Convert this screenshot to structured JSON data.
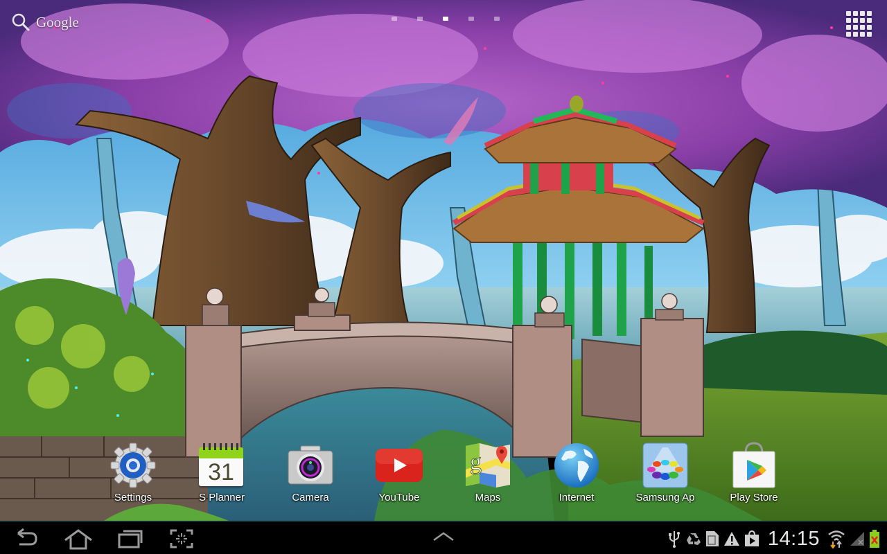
{
  "home_screen": {
    "search_widget": {
      "label": "Google",
      "icon": "search-icon"
    },
    "page_indicator": {
      "page_count": 5,
      "current_page": 3
    },
    "apps_button": {
      "icon": "apps-grid-icon"
    },
    "wallpaper": {
      "description": "Magic garden live wallpaper: purple blossom trees, Chinese pagoda, stone bridge, sea and clouds",
      "colors": {
        "sky": "#5fb8e6",
        "blossom": "#9a4fb5",
        "sea": "#7fb6c6",
        "grass": "#6c9a2a",
        "bark": "#6b4a2c",
        "pagoda_green": "#1fa34a",
        "pagoda_red": "#d8404c"
      }
    },
    "dock": [
      {
        "label": "Settings",
        "icon": "settings-gear-icon"
      },
      {
        "label": "S Planner",
        "icon": "calendar-icon",
        "calendar_day": "31"
      },
      {
        "label": "Camera",
        "icon": "camera-icon"
      },
      {
        "label": "YouTube",
        "icon": "youtube-play-icon"
      },
      {
        "label": "Maps",
        "icon": "maps-icon"
      },
      {
        "label": "Internet",
        "icon": "globe-icon"
      },
      {
        "label": "Samsung Ap",
        "icon": "samsung-apps-icon"
      },
      {
        "label": "Play Store",
        "icon": "play-store-bag-icon"
      }
    ]
  },
  "navigation_bar": {
    "buttons": [
      {
        "name": "back",
        "icon": "back-icon"
      },
      {
        "name": "home",
        "icon": "home-icon"
      },
      {
        "name": "recent_apps",
        "icon": "recent-apps-icon"
      },
      {
        "name": "screenshot",
        "icon": "screenshot-capture-icon"
      }
    ],
    "center_button": {
      "name": "mini_apps_tray",
      "icon": "chevron-up-icon"
    },
    "status": {
      "notification_icons": [
        "usb-icon",
        "recycle-icon",
        "sd-card-icon",
        "warning-icon",
        "play-store-notification-icon"
      ],
      "time": "14:15",
      "wifi": "wifi-data-transfer-icon",
      "signal": "no-signal-icon",
      "battery": "battery-charging-error-icon"
    }
  }
}
